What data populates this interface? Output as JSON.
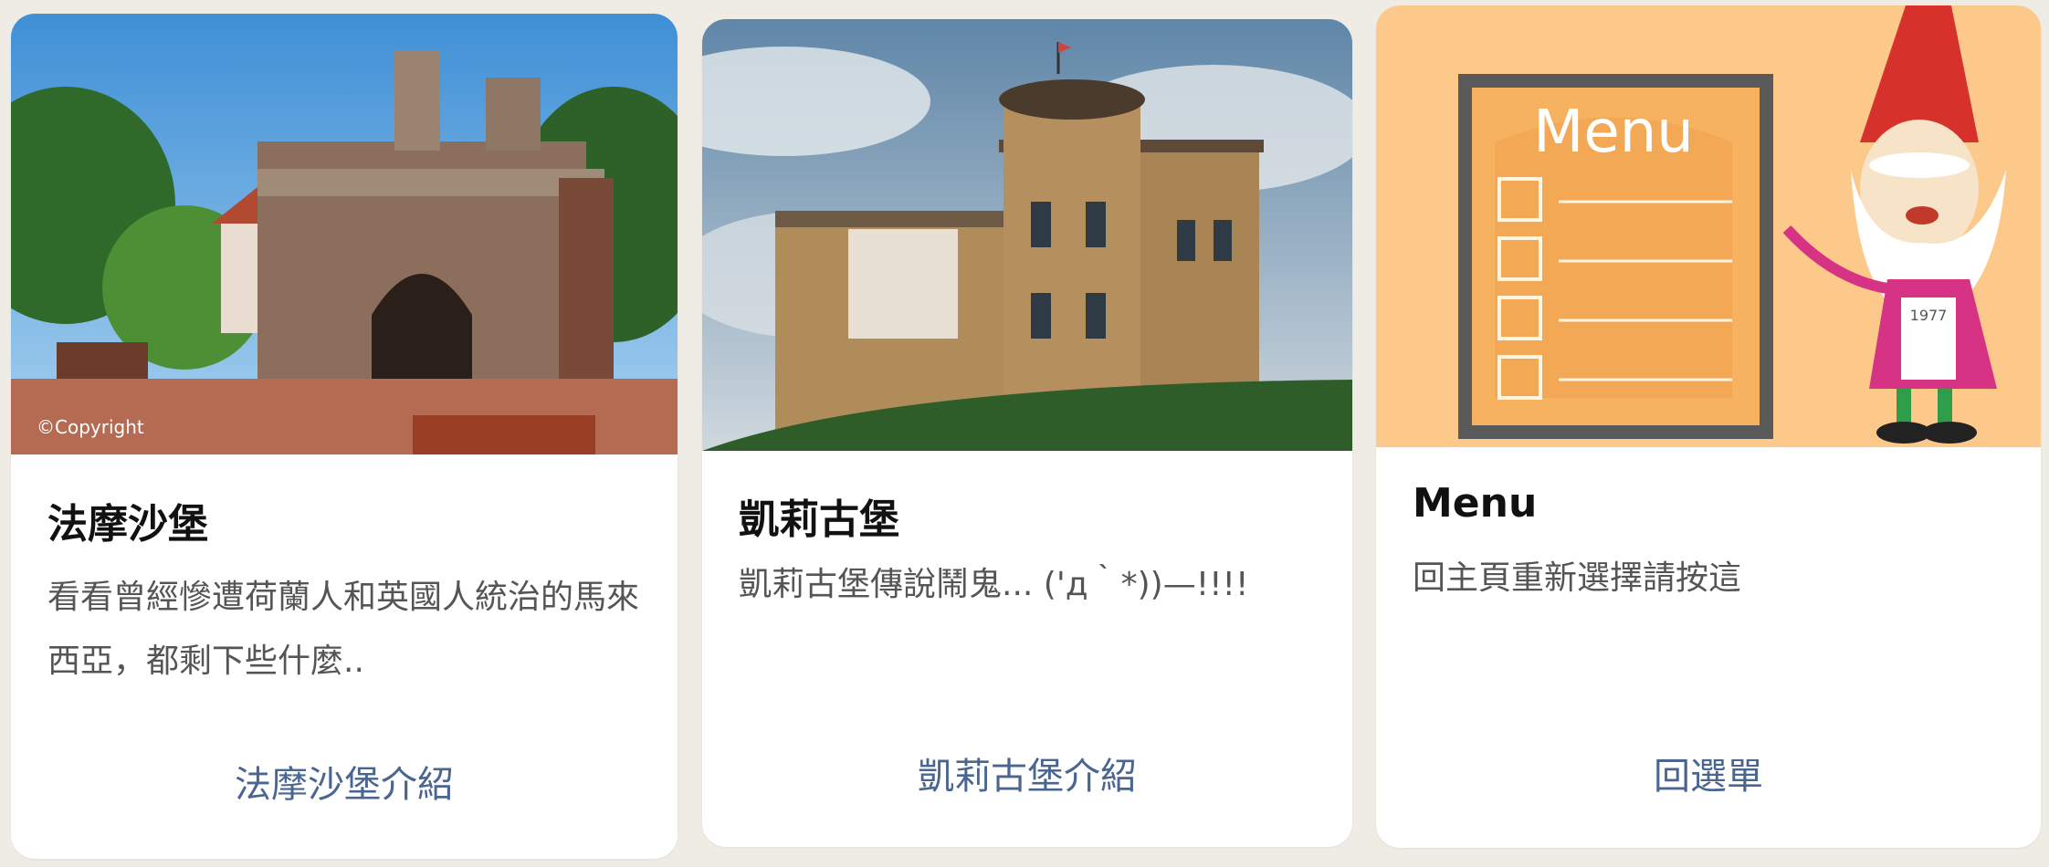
{
  "cards": [
    {
      "title": "法摩沙堡",
      "description": "看看曾經慘遭荷蘭人和英國人統治的馬來西亞，都剩下些什麼..",
      "action_label": "法摩沙堡介紹",
      "image_caption": "©Copyright"
    },
    {
      "title": "凱莉古堡",
      "description": "凱莉古堡傳說鬧鬼... ('д｀*))—!!!!",
      "action_label": "凱莉古堡介紹"
    },
    {
      "title": "Menu",
      "description": "回主頁重新選擇請按這",
      "action_label": "回選單",
      "image_text": "Menu",
      "image_tag": "1977"
    }
  ],
  "colors": {
    "background": "#efebe5",
    "card": "#ffffff",
    "title": "#111111",
    "description": "#555555",
    "action": "#4a6590",
    "menu_image_bg": "#fcc98a"
  }
}
